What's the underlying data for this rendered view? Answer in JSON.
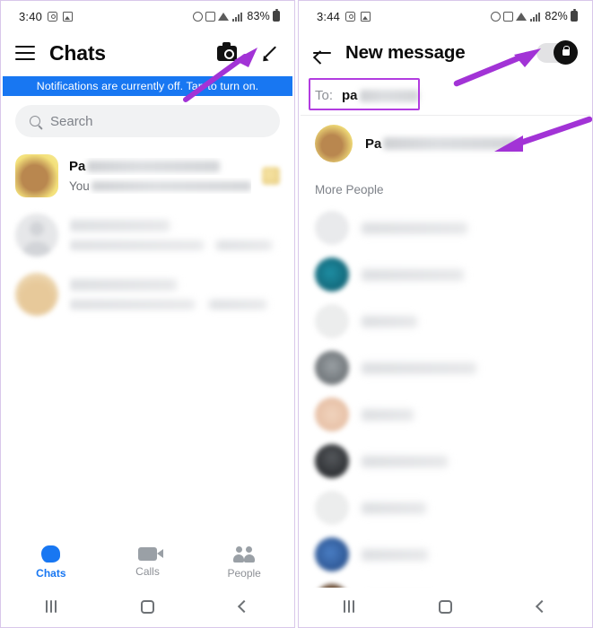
{
  "left_panel": {
    "status_bar": {
      "time": "3:40",
      "battery_percent": "83%",
      "icons": [
        "alarm-icon",
        "photo-icon",
        "wifi-icon",
        "signal-icon",
        "battery-icon"
      ]
    },
    "appbar": {
      "menu_icon": "hamburger-icon",
      "title": "Chats",
      "camera_icon": "camera-icon",
      "compose_icon": "pencil-icon"
    },
    "banner": {
      "text": "Notifications are currently off. Tap to turn on."
    },
    "search": {
      "placeholder": "Search",
      "icon": "search-icon"
    },
    "chats": [
      {
        "name": "Pa",
        "name_redacted": true,
        "preview": "You",
        "preview_redacted": true,
        "blurred": false,
        "has_thumb": true
      },
      {
        "name": "",
        "name_redacted": true,
        "preview": "",
        "preview_redacted": true,
        "blurred": true,
        "has_thumb": false
      },
      {
        "name": "",
        "name_redacted": true,
        "preview": "",
        "preview_redacted": true,
        "blurred": true,
        "has_thumb": false
      }
    ],
    "bottom_nav": [
      {
        "label": "Chats",
        "icon": "chat-bubble-icon",
        "active": true
      },
      {
        "label": "Calls",
        "icon": "video-camera-icon",
        "active": false
      },
      {
        "label": "People",
        "icon": "people-icon",
        "active": false
      }
    ]
  },
  "right_panel": {
    "status_bar": {
      "time": "3:44",
      "battery_percent": "82%",
      "icons": [
        "alarm-icon",
        "photo-icon",
        "wifi-icon",
        "signal-icon",
        "battery-icon"
      ]
    },
    "appbar": {
      "back_icon": "back-arrow-icon",
      "title": "New message",
      "toggle": {
        "name": "secret-conversation-toggle",
        "state": "on",
        "icon": "lock-icon"
      }
    },
    "to_field": {
      "label": "To:",
      "value": "pa",
      "value_redacted": true
    },
    "section_header": "More People",
    "suggested_contact": {
      "name": "Pa",
      "name_redacted": true
    },
    "contacts": [
      {
        "name": "",
        "redacted": true,
        "avatar_color": "#e6e7e9"
      },
      {
        "name": "",
        "redacted": true,
        "avatar_color": "#13697a"
      },
      {
        "name": "",
        "redacted": true,
        "avatar_color": "#e9eaec"
      },
      {
        "name": "",
        "redacted": true,
        "avatar_color": "#8e9296"
      },
      {
        "name": "",
        "redacted": true,
        "avatar_color": "#eccdb9"
      },
      {
        "name": "",
        "redacted": true,
        "avatar_color": "#3a3c3f"
      },
      {
        "name": "",
        "redacted": true,
        "avatar_color": "#e9eaec"
      },
      {
        "name": "",
        "redacted": true,
        "avatar_color": "#2e5fa8"
      },
      {
        "name": "",
        "redacted": true,
        "avatar_color": "#6b4a32"
      }
    ]
  },
  "system_nav": {
    "recent_icon": "recent-apps-icon",
    "home_icon": "home-icon",
    "back_icon": "back-icon"
  },
  "annotations": {
    "arrow_color": "#a233d6",
    "highlight_color": "#b23ce0",
    "arrows": [
      "compose-button-arrow",
      "toggle-arrow",
      "contact-result-arrow"
    ],
    "boxes": [
      "to-field-highlight"
    ]
  },
  "colors": {
    "banner_blue": "#1877F2",
    "accent_blue": "#1877F2",
    "annotation_purple": "#a233d6",
    "panel_border": "#d9c7ea"
  }
}
